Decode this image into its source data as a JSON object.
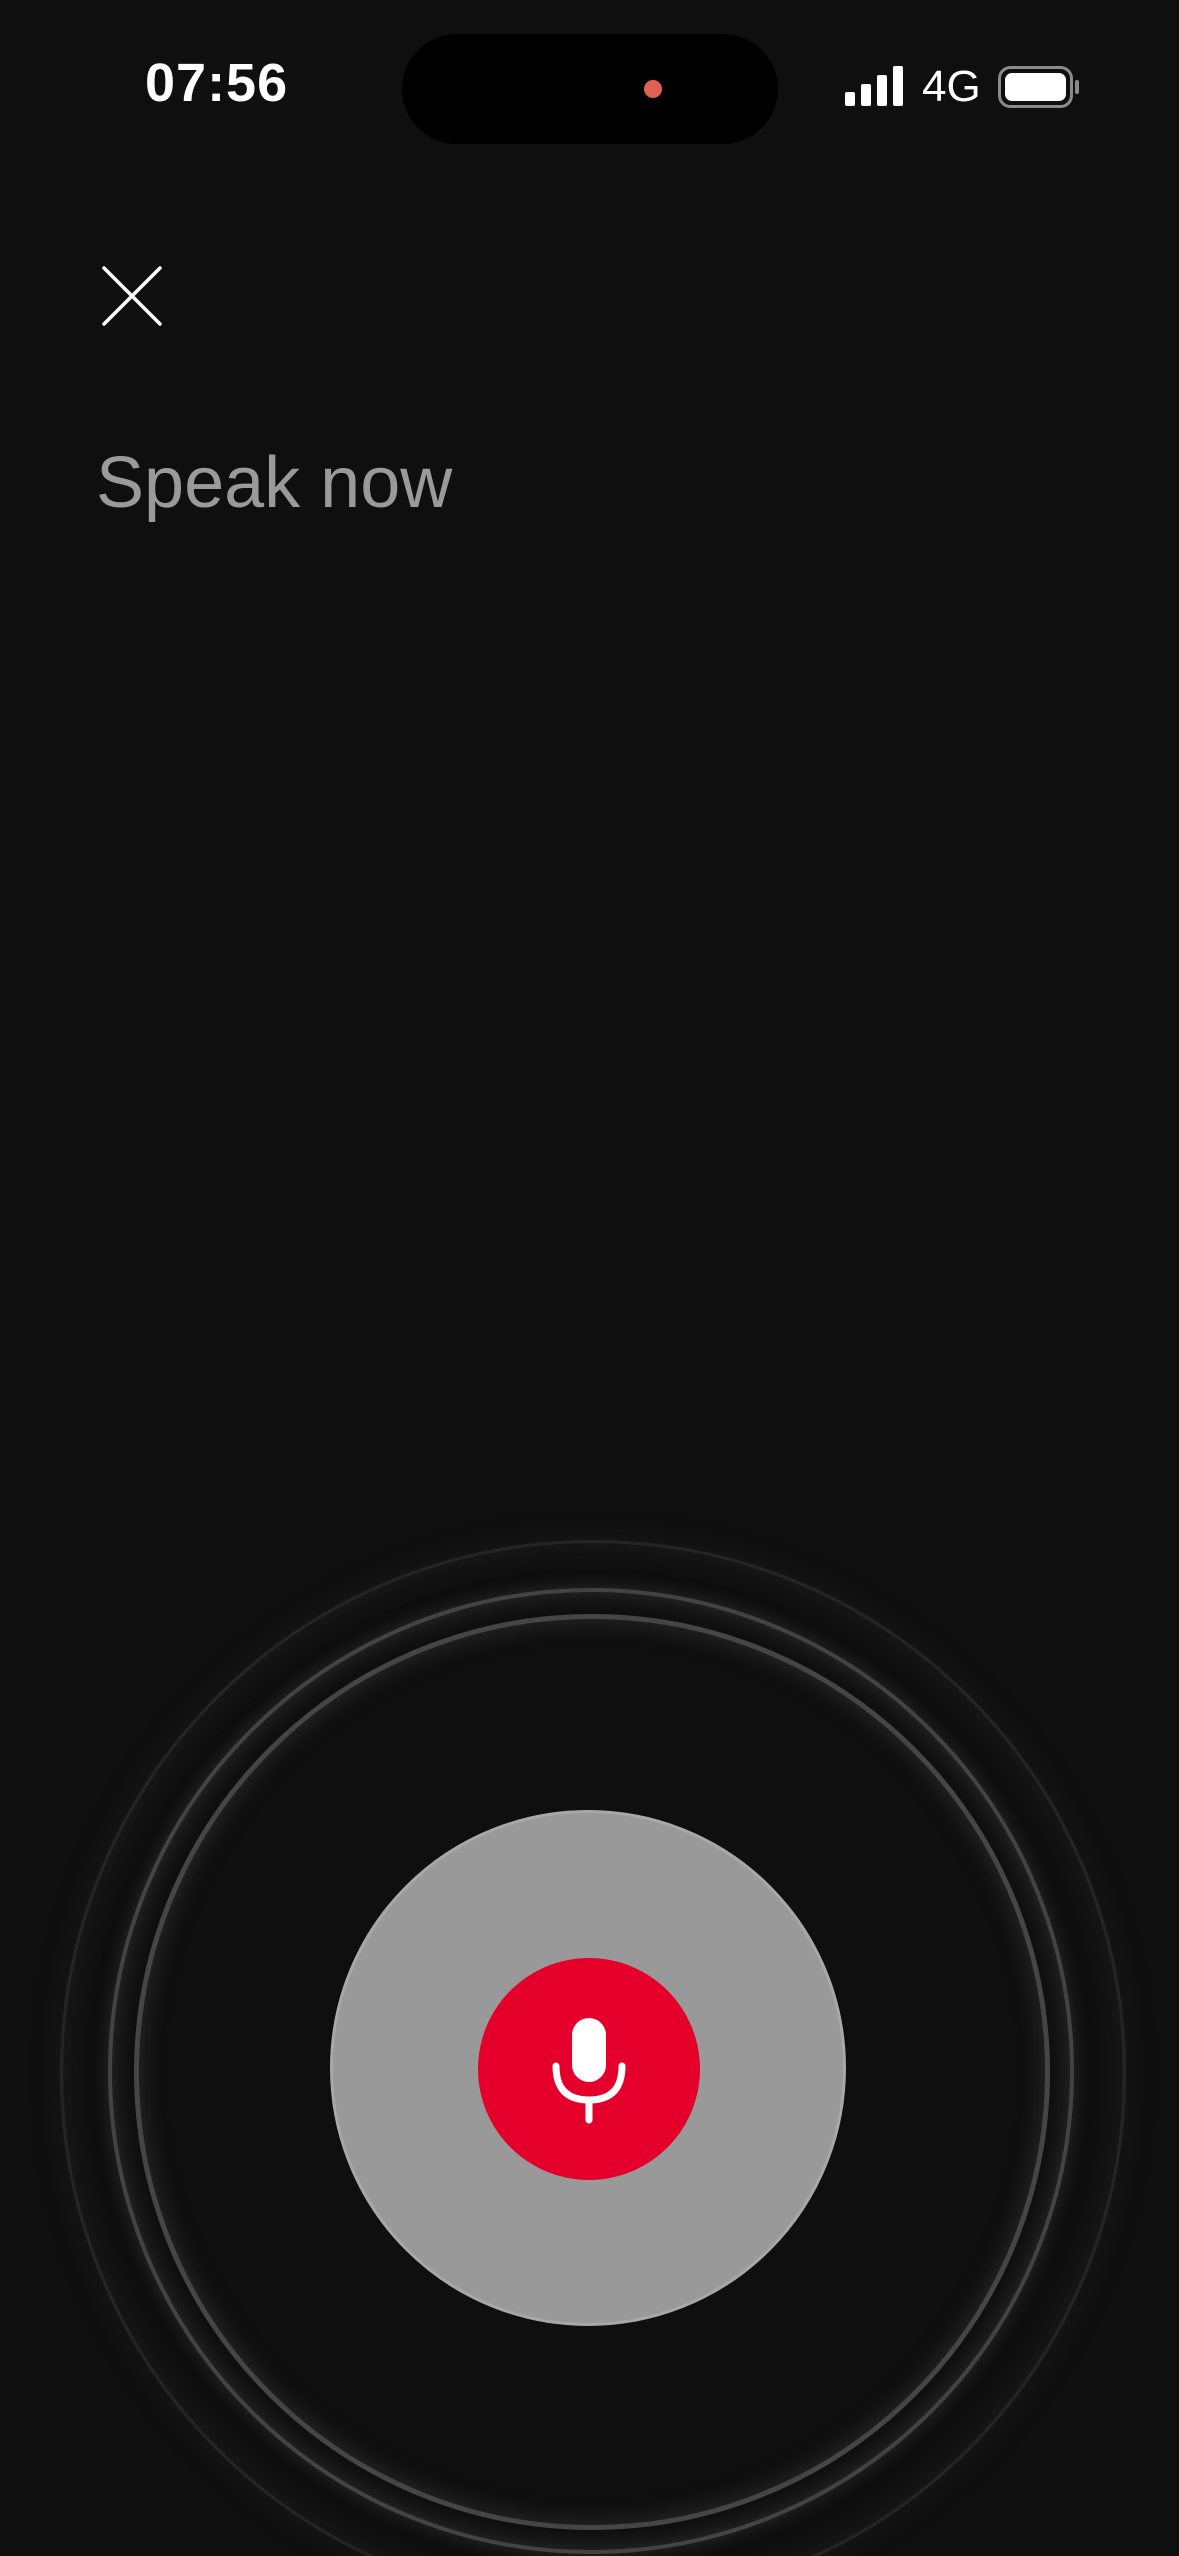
{
  "status_bar": {
    "time": "07:56",
    "network": "4G",
    "signal_icon": "signal-bars-icon",
    "battery_icon": "battery-icon"
  },
  "header": {
    "close_icon": "close-icon"
  },
  "main": {
    "prompt": "Speak now"
  },
  "voice": {
    "mic_icon": "microphone-icon"
  },
  "colors": {
    "background": "#0f0f0f",
    "accent": "#e4002b",
    "prompt_text": "#9a9a9a",
    "pulse": "#999999",
    "island_dot": "#e06154"
  }
}
